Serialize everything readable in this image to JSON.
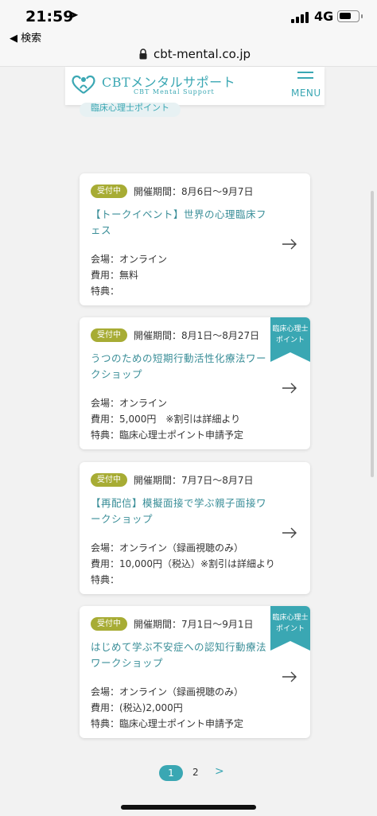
{
  "status_bar": {
    "time": "21:59",
    "network": "4G"
  },
  "browser": {
    "back_label": "◀ 検索",
    "url": "cbt-mental.co.jp"
  },
  "site": {
    "logo_title": "CBTメンタルサポート",
    "logo_subtitle": "CBT Mental Support",
    "menu_label": "MENU",
    "tag_chip": "臨床心理士ポイント"
  },
  "events": [
    {
      "badge": "受付中",
      "period": "開催期間：8月6日〜9月7日",
      "title": "【トークイベント】世界の心理臨床フェス",
      "venue": "会場：オンライン",
      "fee": "費用：無料",
      "perk": "特典：",
      "ribbon": ""
    },
    {
      "badge": "受付中",
      "period": "開催期間：8月1日〜8月27日",
      "title": "うつのための短期行動活性化療法ワークショップ",
      "venue": "会場：オンライン",
      "fee": "費用：5,000円　※割引は詳細より",
      "perk": "特典：臨床心理士ポイント申請予定",
      "ribbon": "臨床心理士ポイント"
    },
    {
      "badge": "受付中",
      "period": "開催期間：7月7日〜8月7日",
      "title": "【再配信】模擬面接で学ぶ親子面接ワークショップ",
      "venue": "会場：オンライン（録画視聴のみ）",
      "fee": "費用：10,000円（税込）※割引は詳細より",
      "perk": "特典：",
      "ribbon": ""
    },
    {
      "badge": "受付中",
      "period": "開催期間：7月1日〜9月1日",
      "title": "はじめて学ぶ不安症への認知行動療法ワークショップ",
      "venue": "会場：オンライン（録画視聴のみ）",
      "fee": "費用：(税込)2,000円",
      "perk": "特典：臨床心理士ポイント申請予定",
      "ribbon": "臨床心理士ポイント"
    }
  ],
  "pagination": {
    "current": "1",
    "next_page": "2",
    "next_arrow": ">"
  },
  "colors": {
    "accent": "#3aa7b3",
    "badge": "#a7ac34",
    "title_text": "#3a8e98"
  }
}
